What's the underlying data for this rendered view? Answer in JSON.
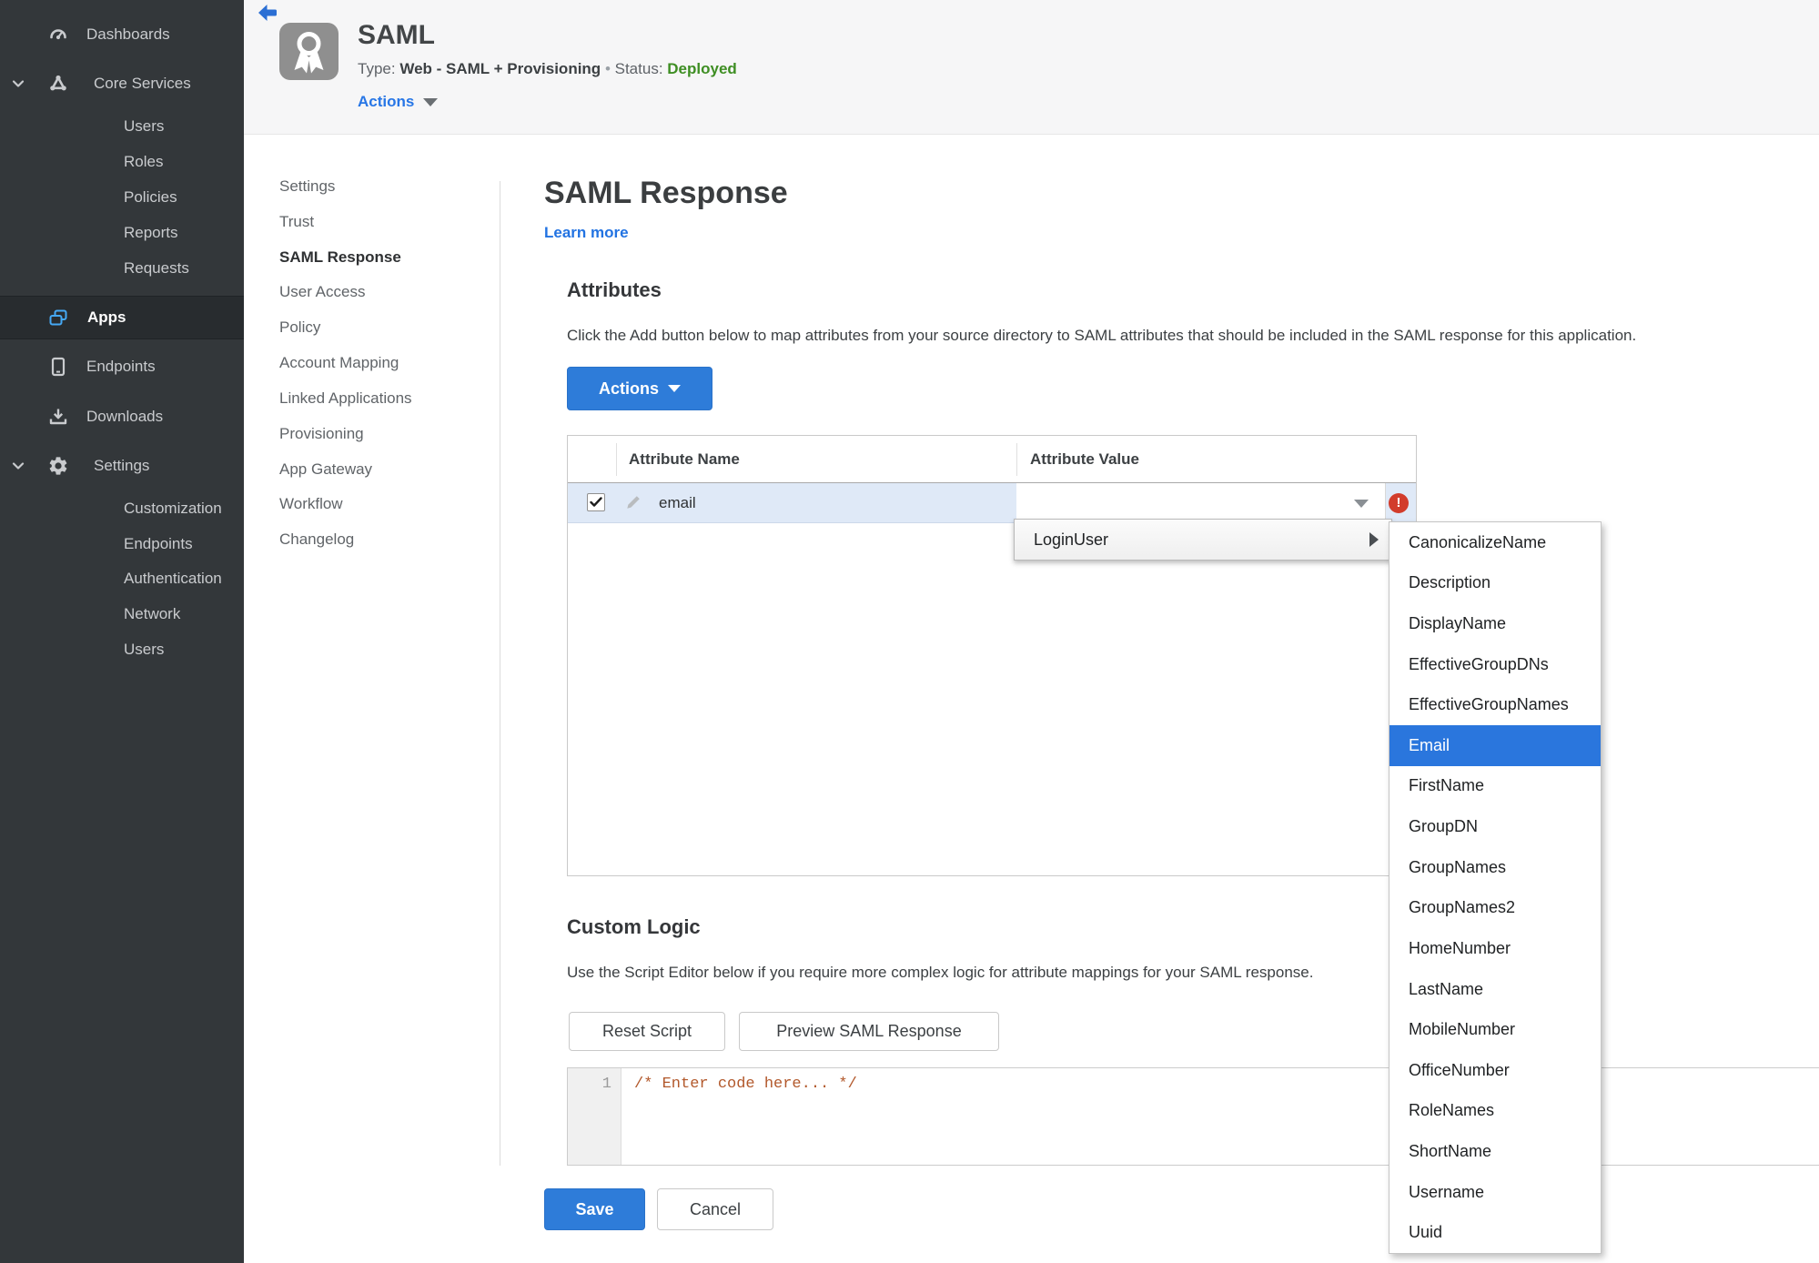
{
  "colors": {
    "accent_blue": "#2e7cd9",
    "link_blue": "#2273e2",
    "selection_blue": "#2a76dd",
    "status_green": "#3e8e23",
    "error_red": "#d23c2b",
    "sidebar_bg": "#33373a",
    "sidebar_active_bg": "#282c2f",
    "header_bg": "#f6f6f7",
    "row_highlight": "#dfe9f7",
    "code_comment": "#b2582b",
    "apps_icon_blue": "#45a9f5"
  },
  "sidebar": {
    "dashboards": "Dashboards",
    "core_services": "Core Services",
    "core_items": [
      "Users",
      "Roles",
      "Policies",
      "Reports",
      "Requests"
    ],
    "apps": "Apps",
    "endpoints": "Endpoints",
    "downloads": "Downloads",
    "settings": "Settings",
    "settings_items": [
      "Customization",
      "Endpoints",
      "Authentication",
      "Network",
      "Users"
    ]
  },
  "header": {
    "title": "SAML",
    "type_label": "Type:",
    "type_value": "Web - SAML + Provisioning",
    "separator": "•",
    "status_label": "Status:",
    "status_value": "Deployed",
    "actions_label": "Actions"
  },
  "nav": {
    "items": [
      "Settings",
      "Trust",
      "SAML Response",
      "User Access",
      "Policy",
      "Account Mapping",
      "Linked Applications",
      "Provisioning",
      "App Gateway",
      "Workflow",
      "Changelog"
    ],
    "active": "SAML Response"
  },
  "main": {
    "title": "SAML Response",
    "learn_more": "Learn more",
    "attributes": {
      "heading": "Attributes",
      "description": "Click the Add button below to map attributes from your source directory to SAML attributes that should be included in the SAML response for this application.",
      "actions_button": "Actions",
      "table": {
        "columns": [
          "Attribute Name",
          "Attribute Value"
        ],
        "row": {
          "name": "email",
          "value": "",
          "checked": true,
          "error": "!"
        }
      }
    },
    "value_menu": {
      "label": "LoginUser",
      "selected": "Email",
      "items": [
        "CanonicalizeName",
        "Description",
        "DisplayName",
        "EffectiveGroupDNs",
        "EffectiveGroupNames",
        "Email",
        "FirstName",
        "GroupDN",
        "GroupNames",
        "GroupNames2",
        "HomeNumber",
        "LastName",
        "MobileNumber",
        "OfficeNumber",
        "RoleNames",
        "ShortName",
        "Username",
        "Uuid"
      ]
    },
    "custom_logic": {
      "heading": "Custom Logic",
      "description": "Use the Script Editor below if you require more complex logic for attribute mappings for your SAML response.",
      "reset_button": "Reset Script",
      "preview_button": "Preview SAML Response",
      "editor": {
        "line_number": "1",
        "code": "/* Enter code here... */"
      }
    },
    "footer": {
      "save": "Save",
      "cancel": "Cancel"
    }
  }
}
